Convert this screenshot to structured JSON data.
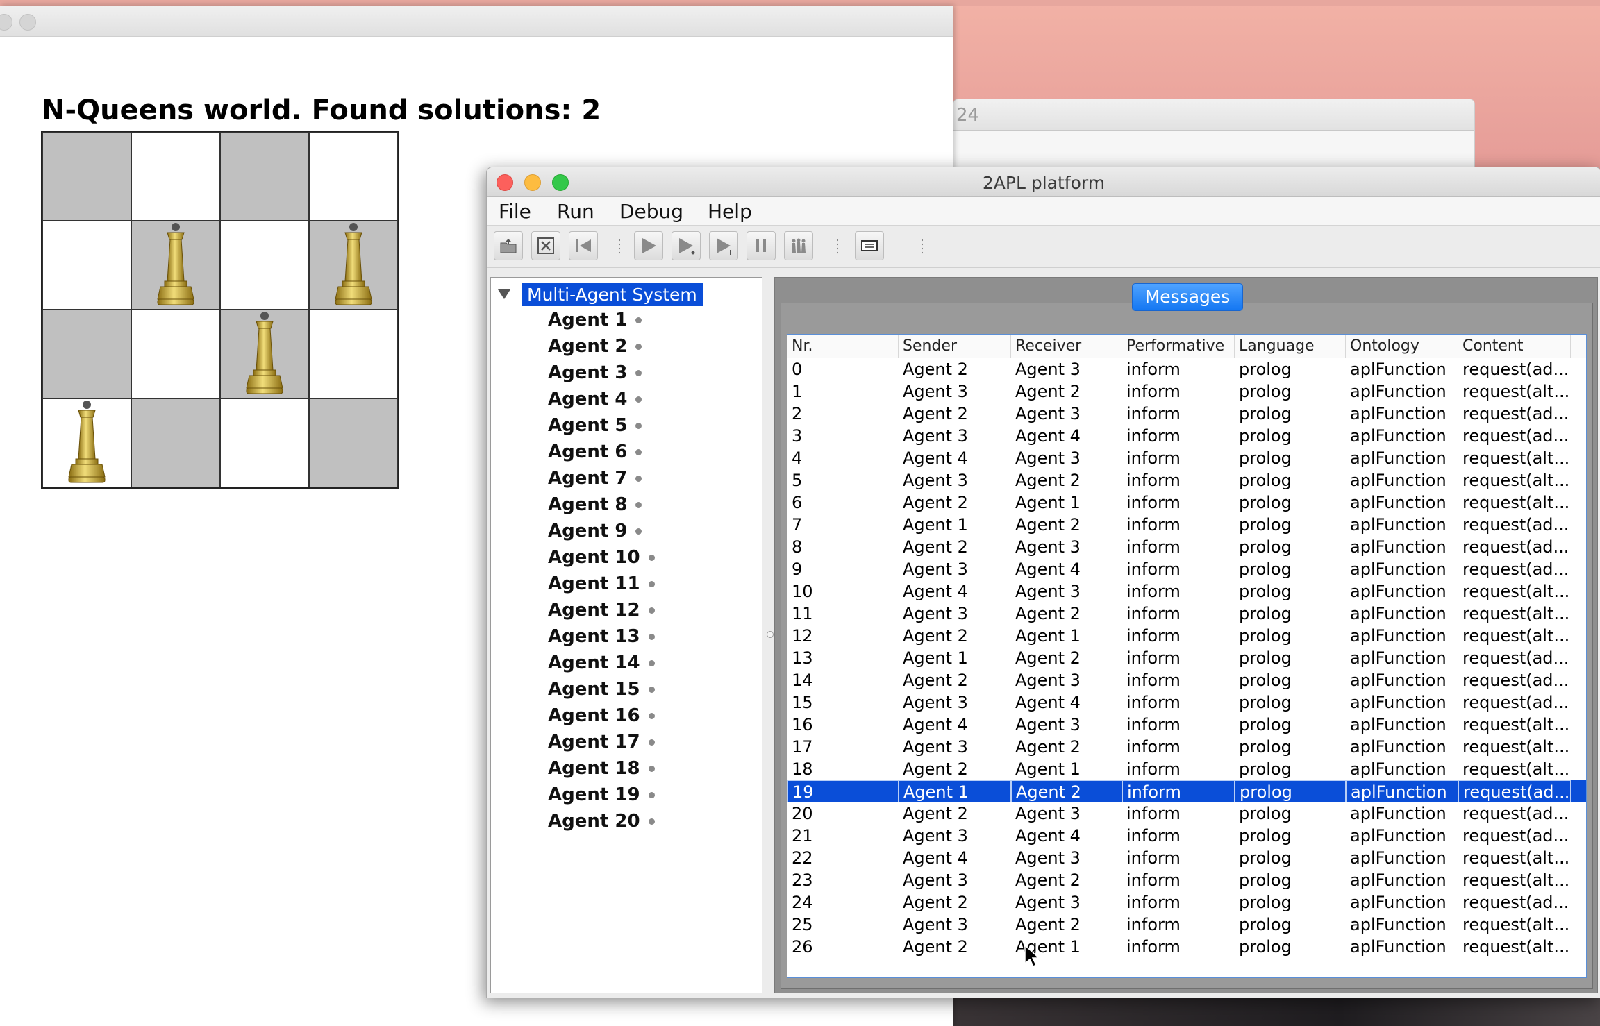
{
  "nqueens": {
    "heading": "N-Queens world. Found solutions: 2",
    "board": {
      "size": 4,
      "queens": [
        {
          "row": 1,
          "col": 1
        },
        {
          "row": 1,
          "col": 3
        },
        {
          "row": 2,
          "col": 2
        },
        {
          "row": 3,
          "col": 0
        }
      ]
    }
  },
  "background_window": {
    "text": "24"
  },
  "apl": {
    "title": "2APL platform",
    "menu": [
      "File",
      "Run",
      "Debug",
      "Help"
    ],
    "toolbar_icons": [
      "open-icon",
      "close-mas-icon",
      "reset-icon",
      "run-icon",
      "step-icon",
      "step-one-icon",
      "pause-icon",
      "agents-icon",
      "message-log-icon"
    ],
    "tree": {
      "root": "Multi-Agent System",
      "agents": [
        "Agent 1",
        "Agent 2",
        "Agent 3",
        "Agent 4",
        "Agent 5",
        "Agent 6",
        "Agent 7",
        "Agent 8",
        "Agent 9",
        "Agent 10",
        "Agent 11",
        "Agent 12",
        "Agent 13",
        "Agent 14",
        "Agent 15",
        "Agent 16",
        "Agent 17",
        "Agent 18",
        "Agent 19",
        "Agent 20"
      ]
    },
    "messages_tab": "Messages",
    "columns": [
      "Nr.",
      "Sender",
      "Receiver",
      "Performative",
      "Language",
      "Ontology",
      "Content"
    ],
    "selected_row": 19,
    "rows": [
      [
        "0",
        "Agent 2",
        "Agent 3",
        "inform",
        "prolog",
        "aplFunction",
        "request(ad..."
      ],
      [
        "1",
        "Agent 3",
        "Agent 2",
        "inform",
        "prolog",
        "aplFunction",
        "request(alt..."
      ],
      [
        "2",
        "Agent 2",
        "Agent 3",
        "inform",
        "prolog",
        "aplFunction",
        "request(ad..."
      ],
      [
        "3",
        "Agent 3",
        "Agent 4",
        "inform",
        "prolog",
        "aplFunction",
        "request(ad..."
      ],
      [
        "4",
        "Agent 4",
        "Agent 3",
        "inform",
        "prolog",
        "aplFunction",
        "request(alt..."
      ],
      [
        "5",
        "Agent 3",
        "Agent 2",
        "inform",
        "prolog",
        "aplFunction",
        "request(alt..."
      ],
      [
        "6",
        "Agent 2",
        "Agent 1",
        "inform",
        "prolog",
        "aplFunction",
        "request(alt..."
      ],
      [
        "7",
        "Agent 1",
        "Agent 2",
        "inform",
        "prolog",
        "aplFunction",
        "request(ad..."
      ],
      [
        "8",
        "Agent 2",
        "Agent 3",
        "inform",
        "prolog",
        "aplFunction",
        "request(ad..."
      ],
      [
        "9",
        "Agent 3",
        "Agent 4",
        "inform",
        "prolog",
        "aplFunction",
        "request(ad..."
      ],
      [
        "10",
        "Agent 4",
        "Agent 3",
        "inform",
        "prolog",
        "aplFunction",
        "request(alt..."
      ],
      [
        "11",
        "Agent 3",
        "Agent 2",
        "inform",
        "prolog",
        "aplFunction",
        "request(alt..."
      ],
      [
        "12",
        "Agent 2",
        "Agent 1",
        "inform",
        "prolog",
        "aplFunction",
        "request(alt..."
      ],
      [
        "13",
        "Agent 1",
        "Agent 2",
        "inform",
        "prolog",
        "aplFunction",
        "request(ad..."
      ],
      [
        "14",
        "Agent 2",
        "Agent 3",
        "inform",
        "prolog",
        "aplFunction",
        "request(ad..."
      ],
      [
        "15",
        "Agent 3",
        "Agent 4",
        "inform",
        "prolog",
        "aplFunction",
        "request(ad..."
      ],
      [
        "16",
        "Agent 4",
        "Agent 3",
        "inform",
        "prolog",
        "aplFunction",
        "request(alt..."
      ],
      [
        "17",
        "Agent 3",
        "Agent 2",
        "inform",
        "prolog",
        "aplFunction",
        "request(alt..."
      ],
      [
        "18",
        "Agent 2",
        "Agent 1",
        "inform",
        "prolog",
        "aplFunction",
        "request(alt..."
      ],
      [
        "19",
        "Agent 1",
        "Agent 2",
        "inform",
        "prolog",
        "aplFunction",
        "request(ad..."
      ],
      [
        "20",
        "Agent 2",
        "Agent 3",
        "inform",
        "prolog",
        "aplFunction",
        "request(ad..."
      ],
      [
        "21",
        "Agent 3",
        "Agent 4",
        "inform",
        "prolog",
        "aplFunction",
        "request(ad..."
      ],
      [
        "22",
        "Agent 4",
        "Agent 3",
        "inform",
        "prolog",
        "aplFunction",
        "request(alt..."
      ],
      [
        "23",
        "Agent 3",
        "Agent 2",
        "inform",
        "prolog",
        "aplFunction",
        "request(alt..."
      ],
      [
        "24",
        "Agent 2",
        "Agent 3",
        "inform",
        "prolog",
        "aplFunction",
        "request(ad..."
      ],
      [
        "25",
        "Agent 3",
        "Agent 2",
        "inform",
        "prolog",
        "aplFunction",
        "request(alt..."
      ],
      [
        "26",
        "Agent 2",
        "Agent 1",
        "inform",
        "prolog",
        "aplFunction",
        "request(alt..."
      ]
    ]
  },
  "colors": {
    "selection": "#0a4ed8",
    "tab": "#1477f2",
    "dark_square": "#c0c0c0",
    "queen_gold": "#c9a93a"
  }
}
